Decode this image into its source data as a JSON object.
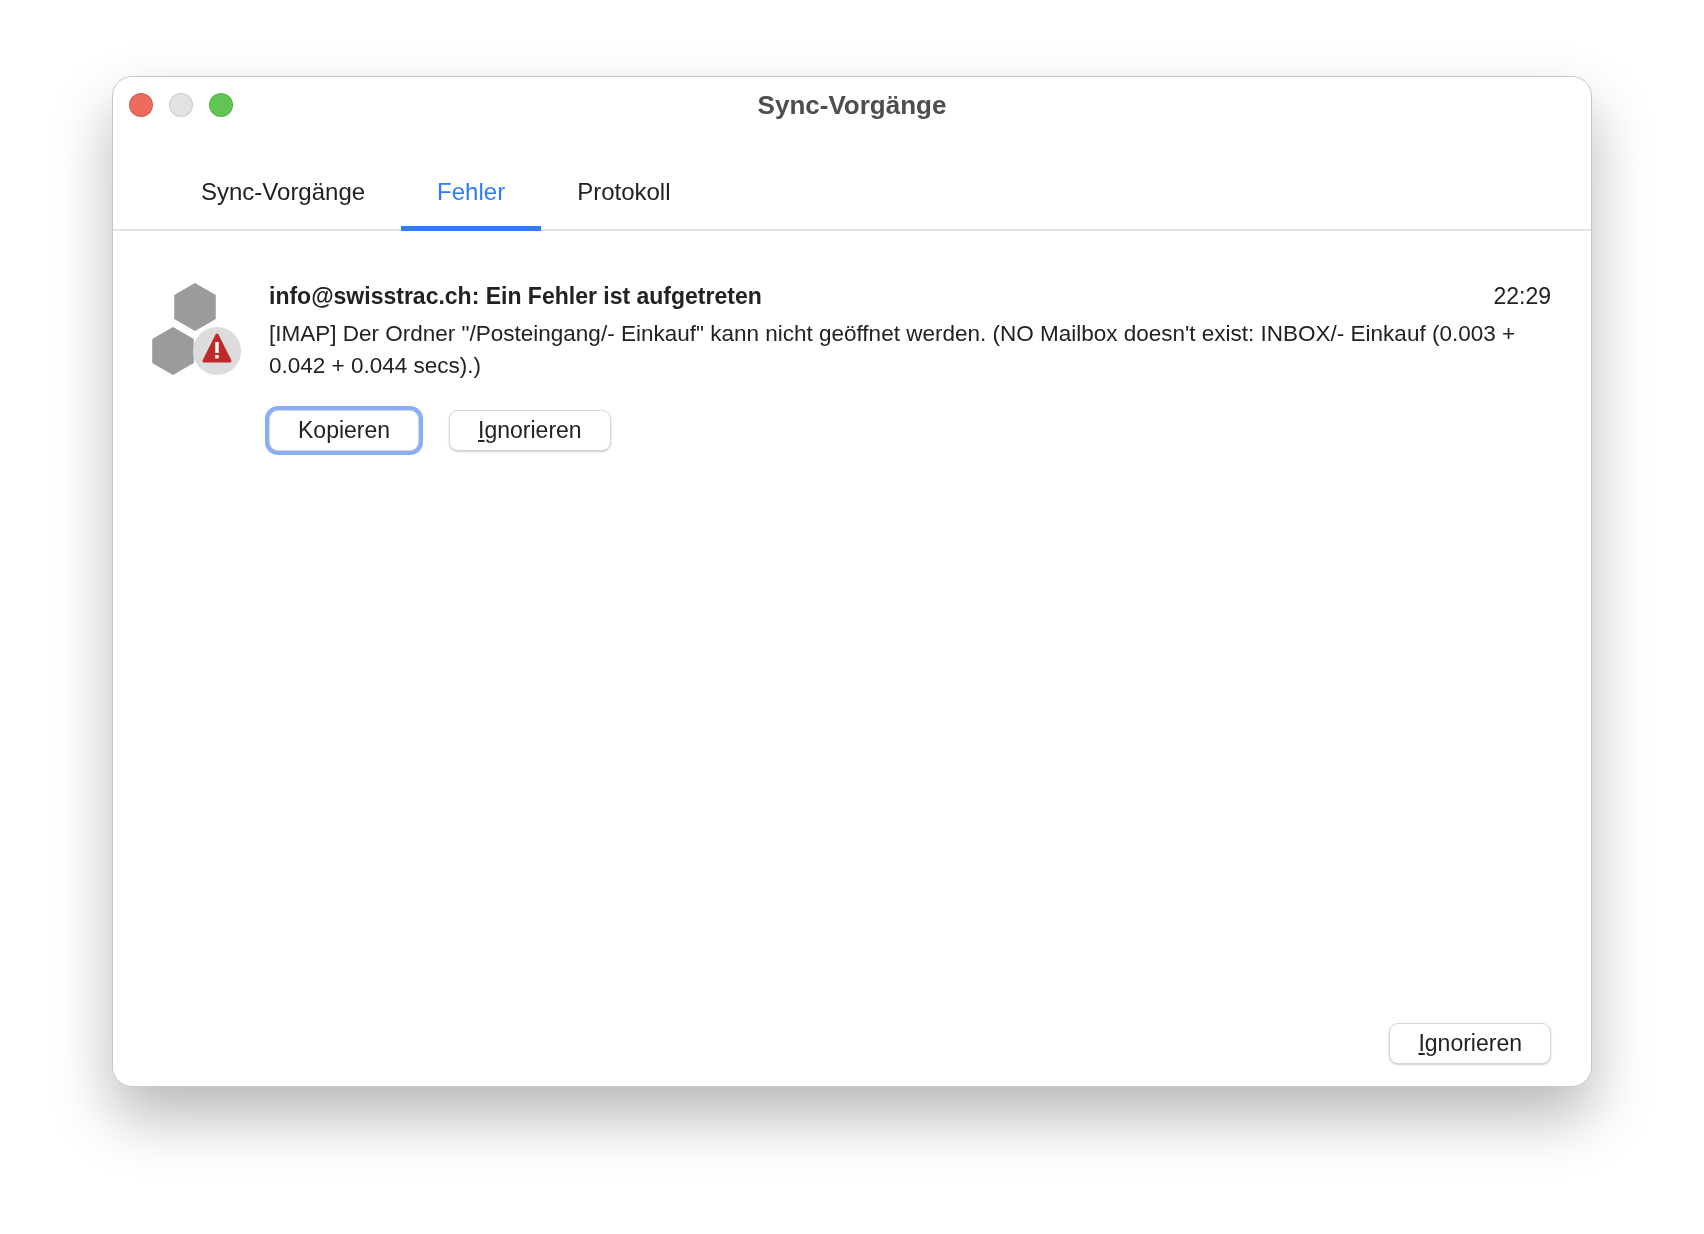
{
  "window": {
    "title": "Sync-Vorgänge"
  },
  "tabs": [
    {
      "label": "Sync-Vorgänge",
      "selected": false
    },
    {
      "label": "Fehler",
      "selected": true
    },
    {
      "label": "Protokoll",
      "selected": false
    }
  ],
  "errors": [
    {
      "title": "info@swisstrac.ch: Ein Fehler ist aufgetreten",
      "time": "22:29",
      "message": "[IMAP] Der Ordner \"/Posteingang/- Einkauf\" kann nicht geöffnet werden. (NO Mailbox doesn't exist: INBOX/- Einkauf (0.003 + 0.042 + 0.044 secs).)",
      "buttons": [
        {
          "label": "Kopieren",
          "focused": true
        },
        {
          "label": "Ignorieren",
          "focused": false
        }
      ]
    }
  ],
  "footer_button": "Ignorieren"
}
